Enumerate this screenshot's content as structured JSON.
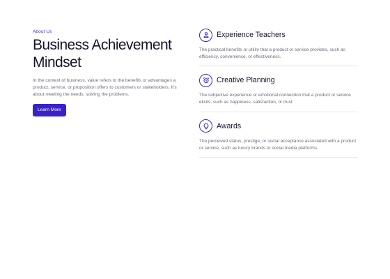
{
  "about": {
    "eyebrow": "About Us",
    "title_line1": "Business Achievement",
    "title_line2": "Mindset",
    "description": "In the context of business, value refers to the benefits or advantages a product, service, or proposition offers to customers or stakeholders. It's about meeting the needs, solving the problems.",
    "button_label": "Learn More"
  },
  "features": [
    {
      "icon": "person-icon",
      "title": "Experience Teachers",
      "description": "The practical benefits or utility that a product or service provides, such as efficiency, convenience, or effectiveness."
    },
    {
      "icon": "alarm-clock-icon",
      "title": "Creative Planning",
      "description": "The subjective experience or emotional connection that a product or service elicits, such as happiness, satisfaction, or trust."
    },
    {
      "icon": "lightbulb-icon",
      "title": "Awards",
      "description": "The perceived status, prestige, or social acceptance associated with a product or service, such as luxury brands or social media platforms."
    }
  ],
  "colors": {
    "accent": "#3a22c9",
    "heading": "#141428",
    "body_text": "#6b6b7b",
    "divider": "#e6e6ec"
  }
}
